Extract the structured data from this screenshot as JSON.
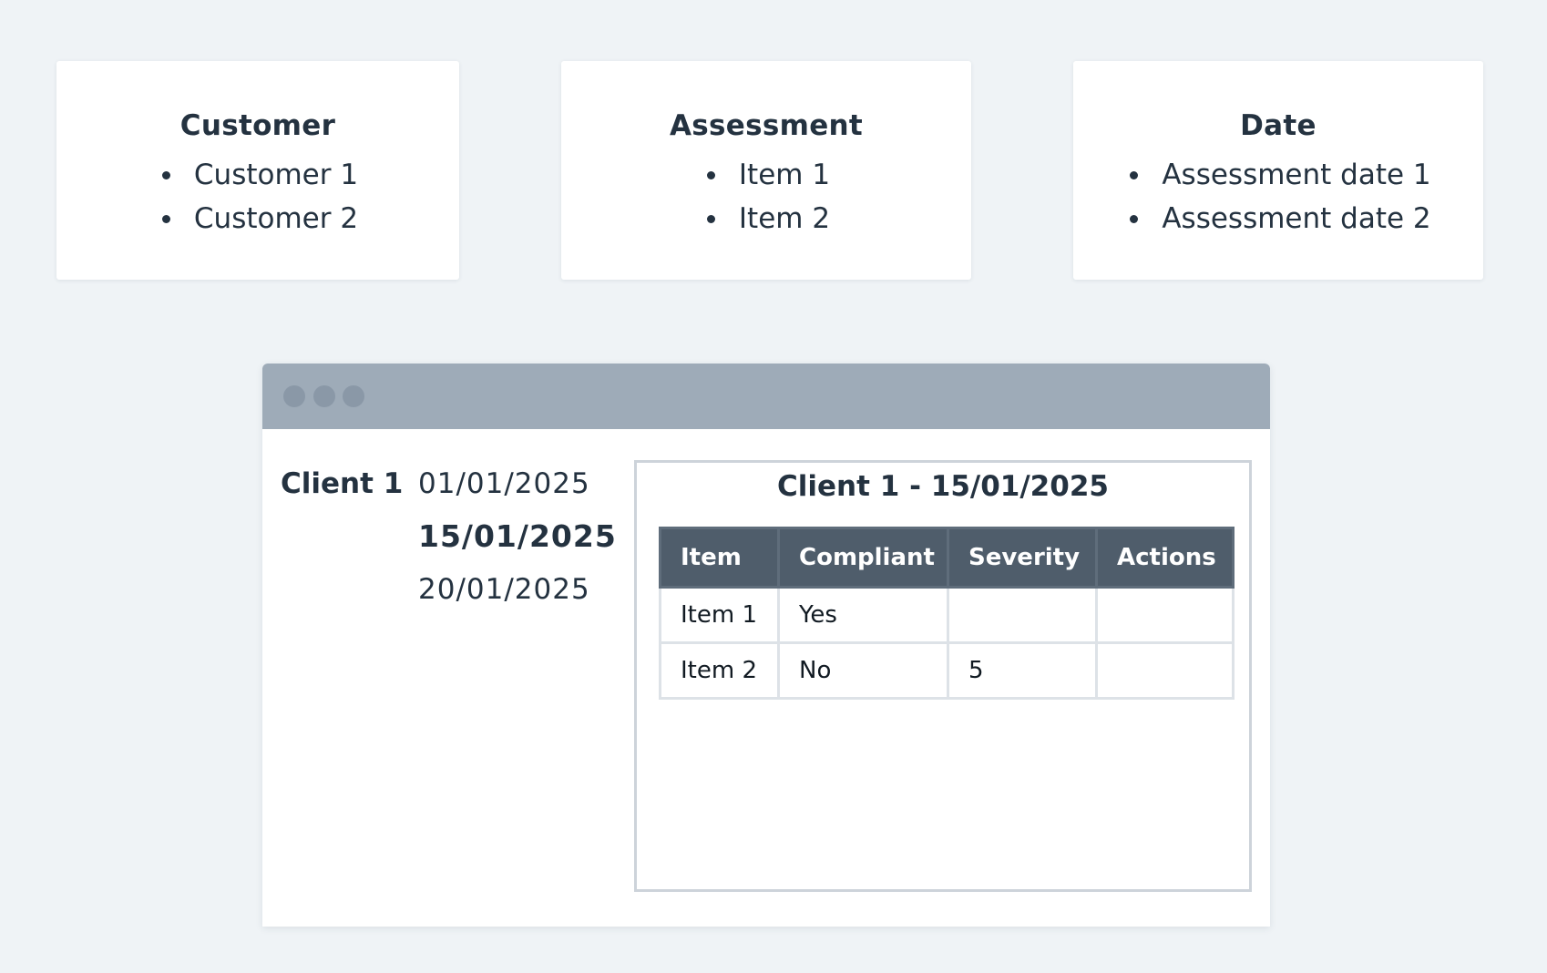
{
  "filters": {
    "customer": {
      "title": "Customer",
      "items": [
        "Customer 1",
        "Customer 2"
      ]
    },
    "assessment": {
      "title": "Assessment",
      "items": [
        "Item 1",
        "Item 2"
      ]
    },
    "date": {
      "title": "Date",
      "items": [
        "Assessment date 1",
        "Assessment date 2"
      ]
    }
  },
  "window": {
    "client": "Client 1",
    "dates": [
      "01/01/2025",
      "15/01/2025",
      "20/01/2025"
    ],
    "selected_date_index": 1,
    "detail": {
      "title": "Client 1 - 15/01/2025",
      "table": {
        "headers": [
          "Item",
          "Compliant",
          "Severity",
          "Actions"
        ],
        "rows": [
          [
            "Item 1",
            "Yes",
            "",
            ""
          ],
          [
            "Item 2",
            "No",
            "5",
            ""
          ]
        ]
      }
    }
  },
  "colors": {
    "background": "#eff3f6",
    "titlebar": "#9eabb8",
    "table_header": "#4f5d6b",
    "text": "#243240"
  }
}
